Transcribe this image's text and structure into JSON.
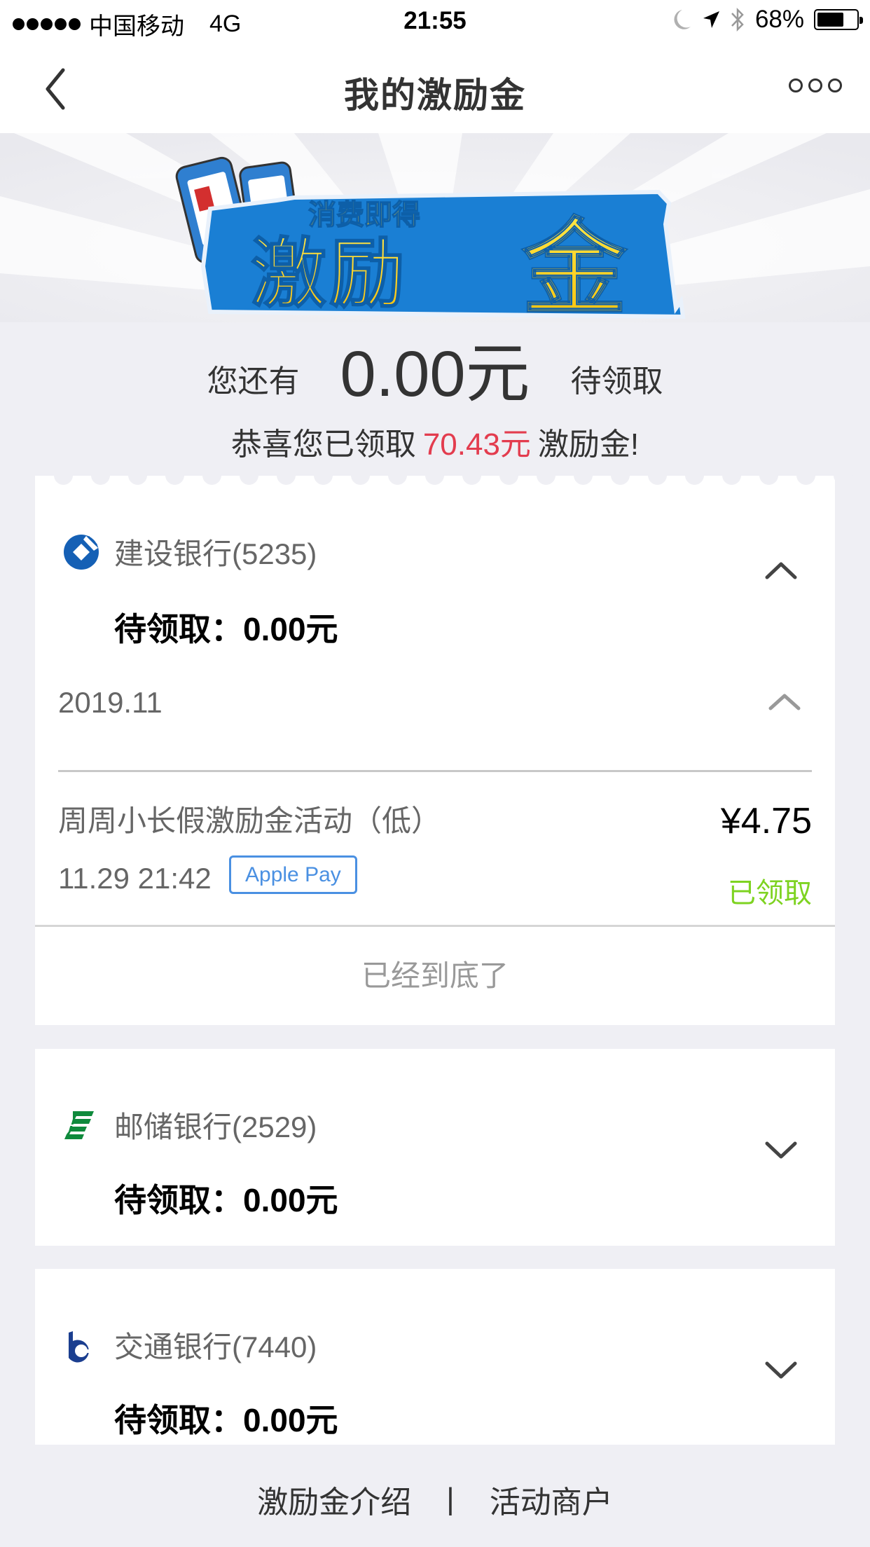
{
  "status_bar": {
    "carrier": "中国移动",
    "network": "4G",
    "time": "21:55",
    "battery_percent_label": "68%",
    "battery_level": 0.68,
    "icons": [
      "moon-icon",
      "location-arrow-icon",
      "bluetooth-icon",
      "battery-icon"
    ]
  },
  "nav": {
    "title": "我的激励金",
    "back_icon": "chevron-left-icon",
    "more_icon": "more-dots-icon"
  },
  "banner": {
    "subtitle": "消费即得",
    "title": "激励金",
    "colors": {
      "blue": "#1a7fd4",
      "yellow": "#ffd21f"
    }
  },
  "summary": {
    "prefix": "您还有",
    "pending_amount": "0.00元",
    "suffix": "待领取",
    "congrats_prefix": "恭喜您已领取",
    "received_amount": "70.43元",
    "congrats_suffix": "激励金!",
    "highlight_color": "#e33c4e"
  },
  "banks": [
    {
      "name": "建设银行(5235)",
      "pending_label": "待领取：",
      "pending_amount": "0.00元",
      "expanded": true,
      "logo": "ccb-logo-icon",
      "months": [
        {
          "label": "2019.11",
          "expanded": true,
          "transactions": [
            {
              "title": "周周小长假激励金活动（低）",
              "amount": "¥4.75",
              "time": "11.29 21:42",
              "tag": "Apple Pay",
              "status": "已领取"
            }
          ]
        }
      ],
      "end_text": "已经到底了"
    },
    {
      "name": "邮储银行(2529)",
      "pending_label": "待领取：",
      "pending_amount": "0.00元",
      "expanded": false,
      "logo": "psbc-logo-icon"
    },
    {
      "name": "交通银行(7440)",
      "pending_label": "待领取：",
      "pending_amount": "0.00元",
      "expanded": false,
      "logo": "bocom-logo-icon"
    }
  ],
  "footer": {
    "intro_link": "激励金介绍",
    "separator": "|",
    "merchants_link": "活动商户"
  },
  "colors": {
    "page_bg": "#efeff4",
    "status_green": "#7ed321",
    "tag_blue": "#4a90e2"
  }
}
